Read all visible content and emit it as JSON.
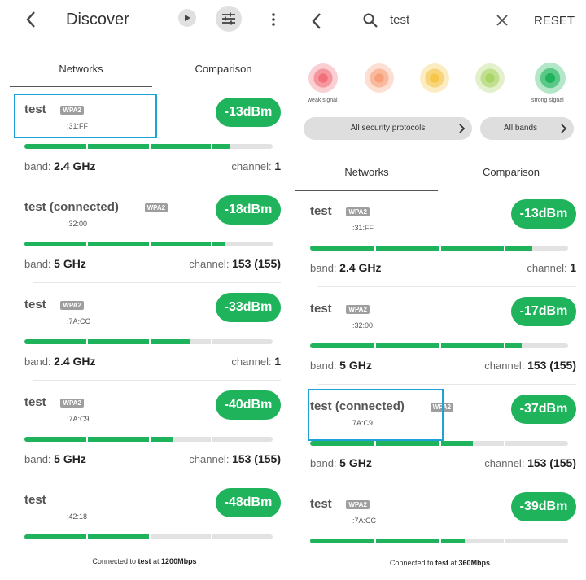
{
  "left": {
    "title": "Discover",
    "tabs": [
      "Networks",
      "Comparison"
    ],
    "networks": [
      {
        "ssid": "test",
        "security": "WPA2",
        "mac": ":31:FF",
        "signal": "-13dBm",
        "band_label": "band:",
        "band": "2.4 GHz",
        "channel_label": "channel:",
        "channel": "1",
        "strength": 0.83
      },
      {
        "ssid": "test (connected)",
        "security": "WPA2",
        "mac": ":32:00",
        "signal": "-18dBm",
        "band_label": "band:",
        "band": "5 GHz",
        "channel_label": "channel:",
        "channel": "153 (155)",
        "strength": 0.81
      },
      {
        "ssid": "test",
        "security": "WPA2",
        "mac": ":7A:CC",
        "signal": "-33dBm",
        "band_label": "band:",
        "band": "2.4 GHz",
        "channel_label": "channel:",
        "channel": "1",
        "strength": 0.67
      },
      {
        "ssid": "test",
        "security": "WPA2",
        "mac": ":7A:C9",
        "signal": "-40dBm",
        "band_label": "band:",
        "band": "5 GHz",
        "channel_label": "channel:",
        "channel": "153 (155)",
        "strength": 0.6
      },
      {
        "ssid": "test",
        "security": "",
        "mac": ":42:18",
        "signal": "-48dBm",
        "band_label": "",
        "band": "",
        "channel_label": "",
        "channel": "",
        "strength": 0.51
      }
    ],
    "footer": {
      "prefix": "Connected to",
      "ssid": "test",
      "at": "at",
      "speed": "1200Mbps"
    }
  },
  "right": {
    "search_value": "test",
    "reset_label": "RESET",
    "signal_legend": {
      "weak": "weak signal",
      "strong": "strong signal"
    },
    "signal_colors": [
      "#f2707a",
      "#f7a07a",
      "#f5c64a",
      "#a9d466",
      "#1fb45c"
    ],
    "filters": {
      "security": "All security protocols",
      "bands": "All bands"
    },
    "tabs": [
      "Networks",
      "Comparison"
    ],
    "networks": [
      {
        "ssid": "test",
        "security": "WPA2",
        "mac": ":31:FF",
        "signal": "-13dBm",
        "band_label": "band:",
        "band": "2.4 GHz",
        "channel_label": "channel:",
        "channel": "1",
        "strength": 0.86
      },
      {
        "ssid": "test",
        "security": "WPA2",
        "mac": ":32:00",
        "signal": "-17dBm",
        "band_label": "band:",
        "band": "5 GHz",
        "channel_label": "channel:",
        "channel": "153 (155)",
        "strength": 0.82
      },
      {
        "ssid": "test (connected)",
        "security": "WPA2",
        "mac": "7A:C9",
        "signal": "-37dBm",
        "band_label": "band:",
        "band": "5 GHz",
        "channel_label": "channel:",
        "channel": "153 (155)",
        "strength": 0.63
      },
      {
        "ssid": "test",
        "security": "WPA2",
        "mac": ":7A:CC",
        "signal": "-39dBm",
        "band_label": "",
        "band": "",
        "channel_label": "",
        "channel": "",
        "strength": 0.6
      }
    ],
    "footer": {
      "prefix": "Connected to",
      "ssid": "test",
      "at": "at",
      "speed": "360Mbps"
    }
  },
  "colors": {
    "accent": "#1fb45c",
    "highlight": "#1ea0d8"
  }
}
